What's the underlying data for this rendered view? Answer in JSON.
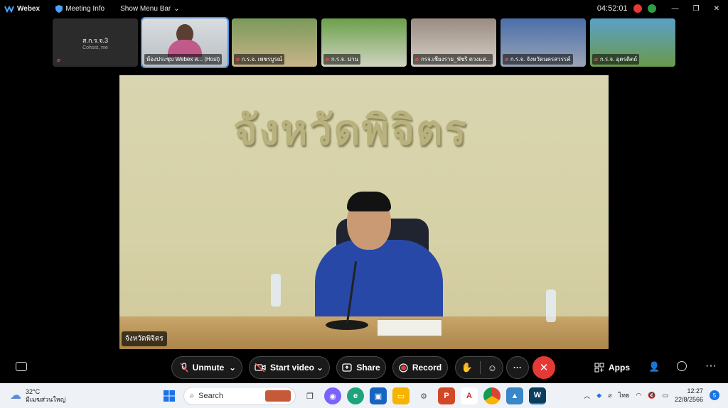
{
  "topbar": {
    "app_name": "Webex",
    "meeting_info": "Meeting Info",
    "show_menu_bar": "Show Menu Bar",
    "timer": "04:52:01"
  },
  "thumbnails": [
    {
      "name": "ส.ก.ร.จ.3",
      "sub": "Cohost, me"
    },
    {
      "name": "ห้องประชุม Webex ส... (Host)"
    },
    {
      "name": "ก.ร.จ. เพชรบูรณ์"
    },
    {
      "name": "ก.ร.จ. น่าน"
    },
    {
      "name": "กรจ.เชียงราย_พัชริ ดวงแส..."
    },
    {
      "name": "ก.ร.จ. จังหวัดนครสวรรค์"
    },
    {
      "name": "ก.ร.จ. อุตรดิตถ์"
    }
  ],
  "stage": {
    "wall_text": "จังหวัดพิจิตร",
    "label": "จังหวัดพิจิตร"
  },
  "controls": {
    "unmute": "Unmute",
    "start_video": "Start video",
    "share": "Share",
    "record": "Record",
    "apps": "Apps"
  },
  "taskbar": {
    "temperature": "32°C",
    "weather_desc": "มีเมฆส่วนใหญ่",
    "search": "Search",
    "lang": "ไทย",
    "time": "12:27",
    "date": "22/8/2566",
    "notifications": "5"
  }
}
